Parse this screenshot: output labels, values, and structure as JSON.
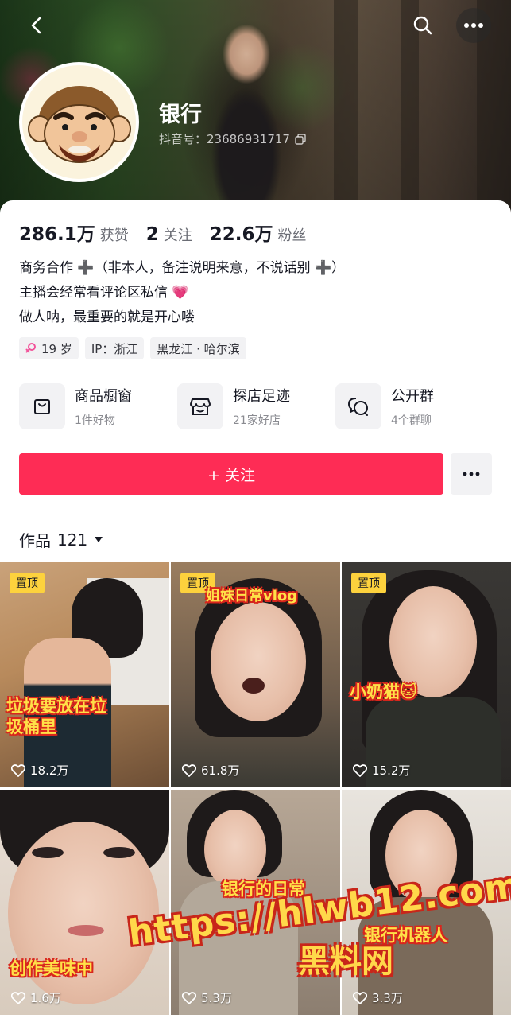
{
  "profile": {
    "nickname": "银行",
    "douyin_id": "抖音号：23686931717"
  },
  "stats": [
    {
      "value": "286.1万",
      "label": "获赞"
    },
    {
      "value": "2",
      "label": "关注"
    },
    {
      "value": "22.6万",
      "label": "粉丝"
    }
  ],
  "bio": [
    "商务合作 ➕（非本人，备注说明来意，不说话别 ➕）",
    "主播会经常看评论区私信 💗",
    "做人呐，最重要的就是开心喽"
  ],
  "tags": {
    "age": "19 岁",
    "ip": "IP：浙江",
    "location": "黑龙江 · 哈尔滨"
  },
  "features": [
    {
      "title": "商品橱窗",
      "sub": "1件好物",
      "icon": "shopping-bag-icon"
    },
    {
      "title": "探店足迹",
      "sub": "21家好店",
      "icon": "shop-icon"
    },
    {
      "title": "公开群",
      "sub": "4个群聊",
      "icon": "chat-bubbles-icon"
    }
  ],
  "follow_label": "+ 关注",
  "works": {
    "label": "作品",
    "count": "121"
  },
  "videos": [
    {
      "pinned": "置顶",
      "likes": "18.2万",
      "caption": "垃圾要放在垃\n圾桶里"
    },
    {
      "pinned": "置顶",
      "likes": "61.8万",
      "caption": "姐妹日常vlog"
    },
    {
      "pinned": "置顶",
      "likes": "15.2万",
      "caption": "小奶猫🐱"
    },
    {
      "pinned": "",
      "likes": "1.6万",
      "caption": "创作美味中"
    },
    {
      "pinned": "",
      "likes": "5.3万",
      "caption": "银行的日常"
    },
    {
      "pinned": "",
      "likes": "3.3万",
      "caption": "银行机器人"
    }
  ],
  "watermark": {
    "url": "https://hlwb12.com",
    "name": "黑料网"
  },
  "colors": {
    "accent": "#fe2c55",
    "pin": "#fdd23d"
  }
}
